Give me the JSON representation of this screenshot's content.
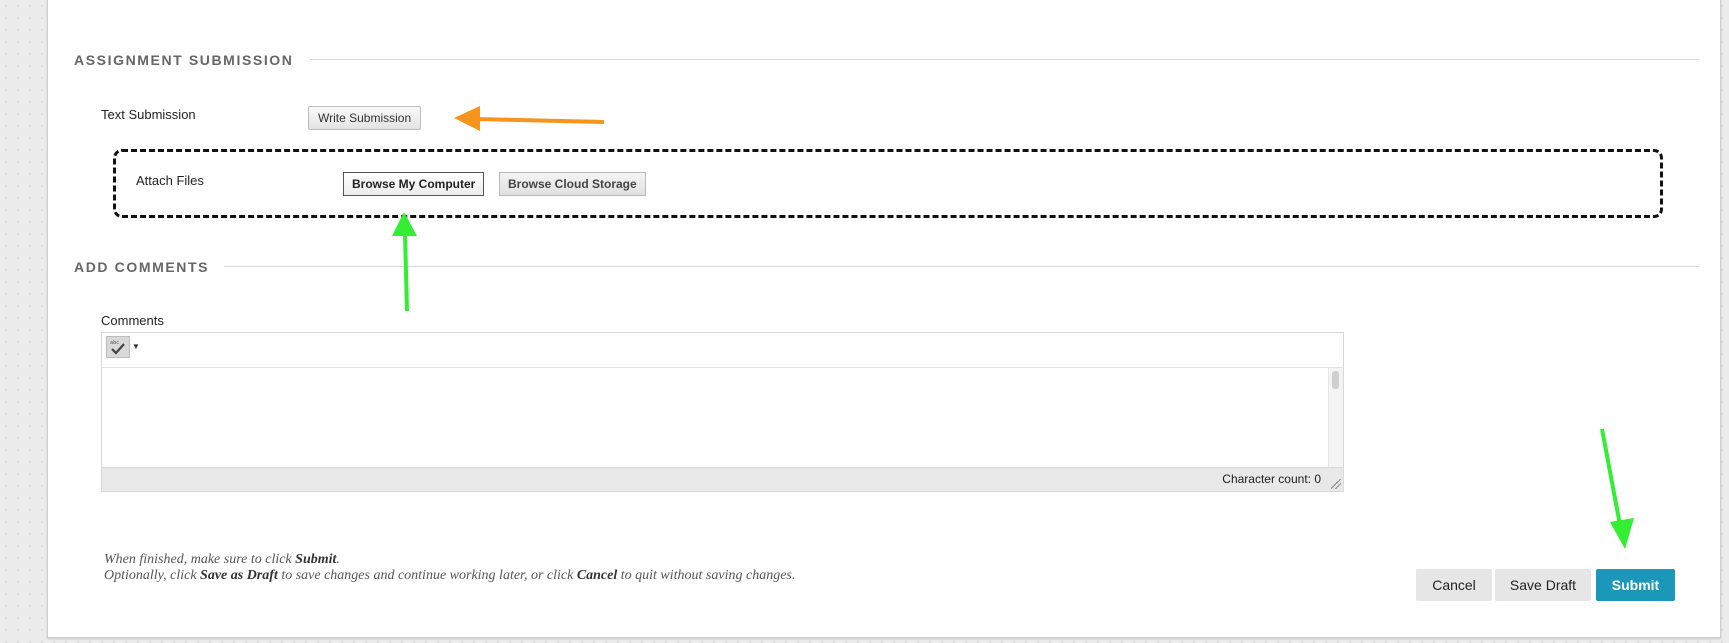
{
  "sections": {
    "assignment_submission": {
      "heading": "ASSIGNMENT SUBMISSION",
      "text_submission_label": "Text Submission",
      "write_submission_button": "Write Submission",
      "attach_files_label": "Attach Files",
      "browse_computer_button": "Browse My Computer",
      "browse_cloud_button": "Browse Cloud Storage"
    },
    "add_comments": {
      "heading": "ADD COMMENTS",
      "comments_label": "Comments",
      "character_count": "Character count: 0"
    }
  },
  "instructions": {
    "line1_prefix": "When finished, make sure to click ",
    "line1_bold": "Submit",
    "line1_suffix": ".",
    "line2_prefix": "Optionally, click ",
    "line2_bold1": "Save as Draft",
    "line2_mid": " to save changes and continue working later, or click ",
    "line2_bold2": "Cancel",
    "line2_suffix": " to quit without saving changes."
  },
  "actions": {
    "cancel": "Cancel",
    "save_draft": "Save Draft",
    "submit": "Submit"
  },
  "annotations": {
    "orange_arrow_color": "#f7941d",
    "green_arrow_color": "#33ee33",
    "highlight_border_color": "#111111"
  },
  "colors": {
    "submit_button": "#1a97b9"
  }
}
